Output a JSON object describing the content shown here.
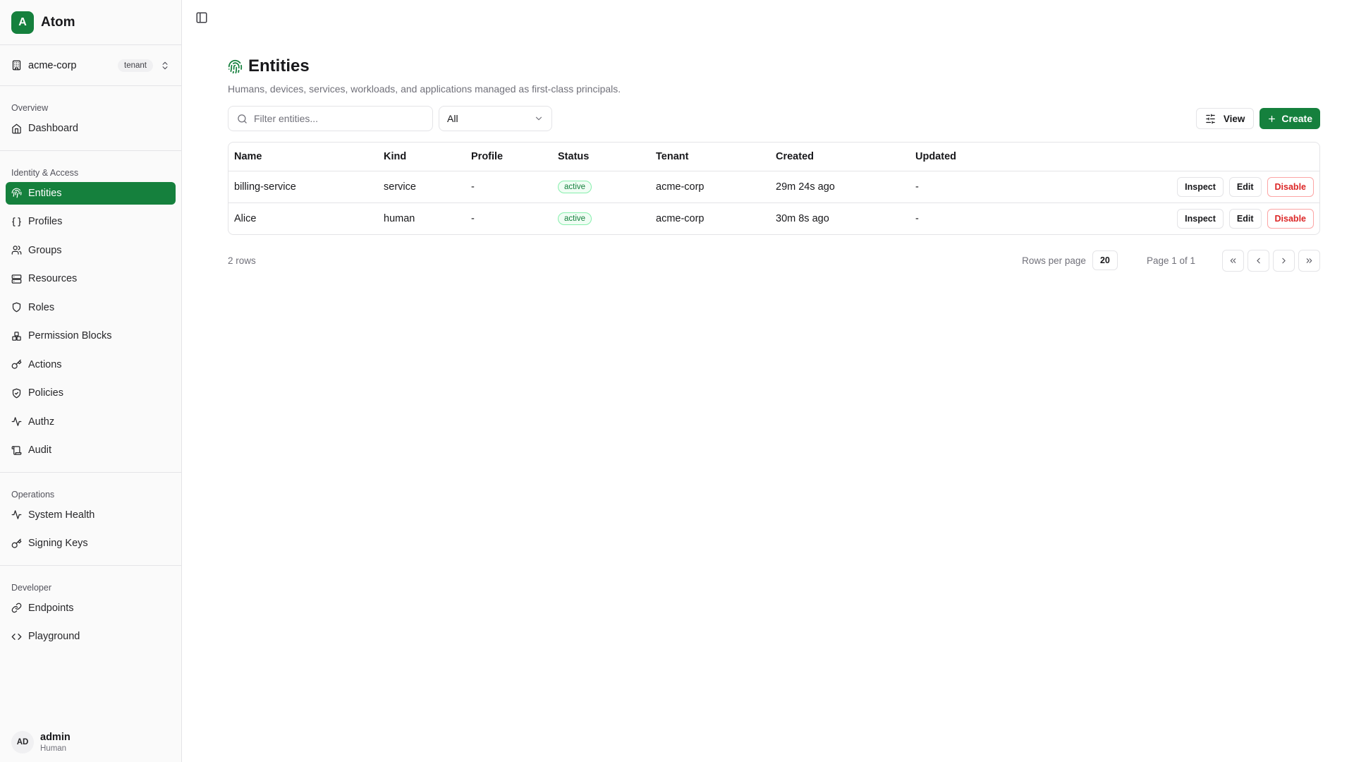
{
  "app": {
    "logo_letter": "A",
    "name": "Atom"
  },
  "tenant": {
    "name": "acme-corp",
    "badge": "tenant"
  },
  "nav": [
    {
      "title": "Overview",
      "items": [
        {
          "label": "Dashboard",
          "icon": "home-icon"
        }
      ]
    },
    {
      "title": "Identity & Access",
      "items": [
        {
          "label": "Entities",
          "icon": "fingerprint-icon",
          "active": true
        },
        {
          "label": "Profiles",
          "icon": "braces-icon"
        },
        {
          "label": "Groups",
          "icon": "users-icon"
        },
        {
          "label": "Resources",
          "icon": "server-icon"
        },
        {
          "label": "Roles",
          "icon": "shield-icon"
        },
        {
          "label": "Permission Blocks",
          "icon": "blocks-icon"
        },
        {
          "label": "Actions",
          "icon": "key-icon"
        },
        {
          "label": "Policies",
          "icon": "shield-check-icon"
        },
        {
          "label": "Authz",
          "icon": "activity-icon"
        },
        {
          "label": "Audit",
          "icon": "scroll-icon"
        }
      ]
    },
    {
      "title": "Operations",
      "items": [
        {
          "label": "System Health",
          "icon": "activity-icon"
        },
        {
          "label": "Signing Keys",
          "icon": "key-icon"
        }
      ]
    },
    {
      "title": "Developer",
      "items": [
        {
          "label": "Endpoints",
          "icon": "link-icon"
        },
        {
          "label": "Playground",
          "icon": "code-icon"
        }
      ]
    }
  ],
  "user": {
    "initials": "AD",
    "name": "admin",
    "role": "Human"
  },
  "page": {
    "title": "Entities",
    "subtitle": "Humans, devices, services, workloads, and applications managed as first-class principals."
  },
  "toolbar": {
    "search_placeholder": "Filter entities...",
    "kind_filter": "All",
    "view_label": "View",
    "create_label": "Create"
  },
  "table": {
    "columns": [
      "Name",
      "Kind",
      "Profile",
      "Status",
      "Tenant",
      "Created",
      "Updated"
    ],
    "rows": [
      {
        "name": "billing-service",
        "kind": "service",
        "profile": "-",
        "status": "active",
        "tenant": "acme-corp",
        "created": "29m 24s ago",
        "updated": "-"
      },
      {
        "name": "Alice",
        "kind": "human",
        "profile": "-",
        "status": "active",
        "tenant": "acme-corp",
        "created": "30m 8s ago",
        "updated": "-"
      }
    ],
    "actions": {
      "inspect": "Inspect",
      "edit": "Edit",
      "disable": "Disable"
    }
  },
  "footer": {
    "row_count": "2 rows",
    "rows_per_page_label": "Rows per page",
    "rows_per_page": "20",
    "page_info": "Page 1 of 1"
  },
  "colors": {
    "accent": "#15803d",
    "danger": "#dc2626",
    "border": "#e4e4e7"
  }
}
